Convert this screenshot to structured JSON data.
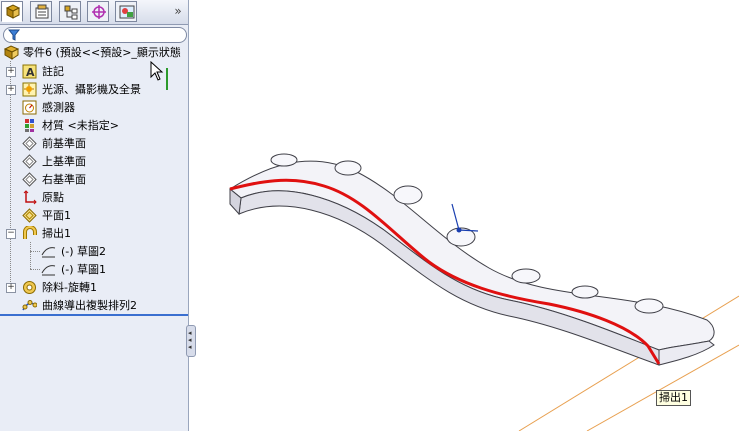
{
  "feature_manager": {
    "tabs": [
      {
        "name": "feature-manager-tab",
        "icon": "feature-tree-icon",
        "active": true
      },
      {
        "name": "property-manager-tab",
        "icon": "property-icon",
        "active": false
      },
      {
        "name": "configuration-manager-tab",
        "icon": "configuration-icon",
        "active": false
      },
      {
        "name": "dimxpert-tab",
        "icon": "target-icon",
        "active": false
      },
      {
        "name": "display-manager-tab",
        "icon": "display-icon",
        "active": false
      }
    ],
    "more_label": "»",
    "filter_icon": "filter-icon",
    "tree": {
      "root": "零件6  (預設<<預設>_顯示狀態",
      "items": [
        {
          "label": "註記",
          "icon": "annotation-icon",
          "expandable": true
        },
        {
          "label": "光源、攝影機及全景",
          "icon": "lights-icon",
          "expandable": true
        },
        {
          "label": "感測器",
          "icon": "sensor-icon",
          "expandable": false
        },
        {
          "label": "材質 <未指定>",
          "icon": "material-icon",
          "expandable": false
        },
        {
          "label": "前基準面",
          "icon": "plane-icon",
          "expandable": false
        },
        {
          "label": "上基準面",
          "icon": "plane-icon",
          "expandable": false
        },
        {
          "label": "右基準面",
          "icon": "plane-icon",
          "expandable": false
        },
        {
          "label": "原點",
          "icon": "origin-icon",
          "expandable": false
        },
        {
          "label": "平面1",
          "icon": "plane-icon",
          "expandable": false
        },
        {
          "label": "掃出1",
          "icon": "sweep-icon",
          "expandable": true,
          "expanded": true
        },
        {
          "label": "(-) 草圖2",
          "icon": "sketch-icon",
          "child": true
        },
        {
          "label": "(-) 草圖1",
          "icon": "sketch-icon",
          "child": true
        },
        {
          "label": "除料-旋轉1",
          "icon": "revolve-cut-icon",
          "expandable": true
        },
        {
          "label": "曲線導出複製排列2",
          "icon": "curve-pattern-icon",
          "expandable": false
        }
      ]
    }
  },
  "viewport": {
    "tooltip": "掃出1",
    "colors": {
      "part_fill": "#f3f3f8",
      "part_edge": "#404048",
      "path_curve": "#e01010",
      "plane_line": "#e8a050",
      "sketch": "#1a3fb0"
    }
  }
}
